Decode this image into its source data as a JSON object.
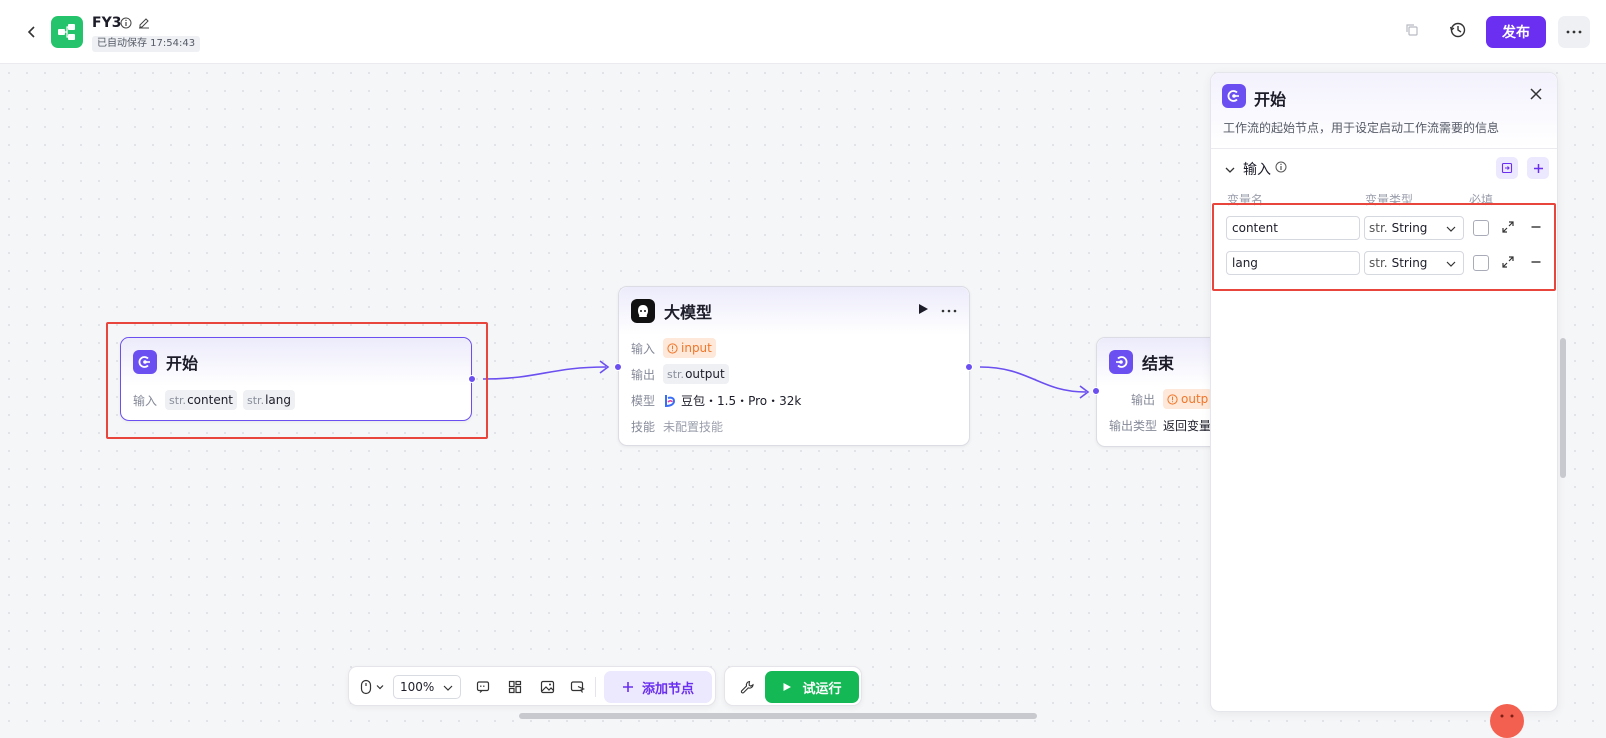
{
  "header": {
    "title": "FY3",
    "autosave": "已自动保存 17:54:43",
    "publish_label": "发布"
  },
  "canvas": {
    "start_node": {
      "title": "开始",
      "input_label": "输入",
      "inputs": [
        {
          "type_prefix": "str.",
          "name": "content"
        },
        {
          "type_prefix": "str.",
          "name": "lang"
        }
      ]
    },
    "llm_node": {
      "title": "大模型",
      "input_label": "输入",
      "input_value": "input",
      "output_label": "输出",
      "output_prefix": "str.",
      "output_value": "output",
      "model_label": "模型",
      "model_value": "豆包・1.5・Pro・32k",
      "skill_label": "技能",
      "skill_value": "未配置技能"
    },
    "end_node": {
      "title": "结束",
      "output_label": "输出",
      "output_value": "outp",
      "output_type_label": "输出类型",
      "output_type_value": "返回变量"
    }
  },
  "toolbar": {
    "zoom": "100%",
    "add_node_label": "添加节点",
    "test_run_label": "试运行"
  },
  "panel": {
    "title": "开始",
    "description": "工作流的起始节点，用于设定启动工作流需要的信息",
    "section_title": "输入",
    "columns": {
      "name": "变量名",
      "type": "变量类型",
      "required": "必填"
    },
    "variables": [
      {
        "name": "content",
        "type_prefix": "str.",
        "type": "String",
        "required": false
      },
      {
        "name": "lang",
        "type_prefix": "str.",
        "type": "String",
        "required": false
      }
    ]
  },
  "colors": {
    "accent": "#6a2ff0",
    "node_accent": "#6b4ff0",
    "success": "#14b855",
    "highlight": "#e8453c",
    "warn": "#f0762a"
  }
}
